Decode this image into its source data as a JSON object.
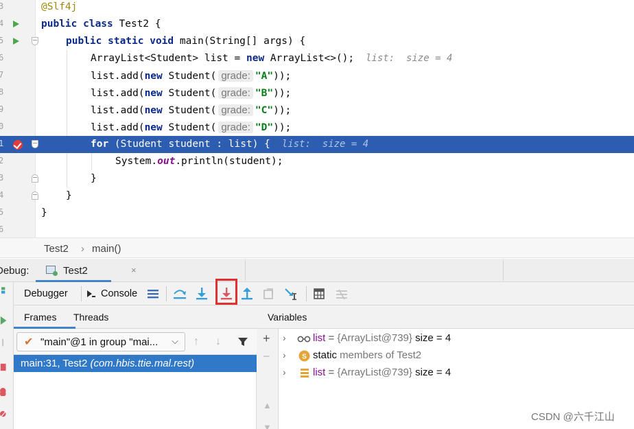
{
  "editor": {
    "lines": [
      {
        "num": "3",
        "tokens": [
          {
            "c": "ann",
            "t": "@Slf4j"
          }
        ]
      },
      {
        "num": "4",
        "tokens": [
          {
            "c": "kw",
            "t": "public "
          },
          {
            "c": "kw",
            "t": "class "
          },
          {
            "c": "",
            "t": "Test2 {"
          }
        ]
      },
      {
        "num": "5",
        "tokens": [
          {
            "c": "kw",
            "t": "public "
          },
          {
            "c": "kw",
            "t": "static "
          },
          {
            "c": "kw",
            "t": "void "
          },
          {
            "c": "",
            "t": "main(String[] args) {"
          }
        ]
      },
      {
        "num": "6",
        "tokens": [
          {
            "c": "",
            "t": "ArrayList<Student> list = "
          },
          {
            "c": "kw",
            "t": "new "
          },
          {
            "c": "",
            "t": "ArrayList<>();"
          },
          {
            "c": "inline-val",
            "t": "  list:  size = 4"
          }
        ]
      },
      {
        "num": "7",
        "tokens": [
          {
            "c": "",
            "t": "list.add("
          },
          {
            "c": "kw",
            "t": "new "
          },
          {
            "c": "",
            "t": "Student("
          },
          {
            "c": "hint",
            "t": "grade:"
          },
          {
            "c": "str",
            "t": "\"A\""
          },
          {
            "c": "",
            "t": "));"
          }
        ]
      },
      {
        "num": "8",
        "tokens": [
          {
            "c": "",
            "t": "list.add("
          },
          {
            "c": "kw",
            "t": "new "
          },
          {
            "c": "",
            "t": "Student("
          },
          {
            "c": "hint",
            "t": "grade:"
          },
          {
            "c": "str",
            "t": "\"B\""
          },
          {
            "c": "",
            "t": "));"
          }
        ]
      },
      {
        "num": "9",
        "tokens": [
          {
            "c": "",
            "t": "list.add("
          },
          {
            "c": "kw",
            "t": "new "
          },
          {
            "c": "",
            "t": "Student("
          },
          {
            "c": "hint",
            "t": "grade:"
          },
          {
            "c": "str",
            "t": "\"C\""
          },
          {
            "c": "",
            "t": "));"
          }
        ]
      },
      {
        "num": "0",
        "tokens": [
          {
            "c": "",
            "t": "list.add("
          },
          {
            "c": "kw",
            "t": "new "
          },
          {
            "c": "",
            "t": "Student("
          },
          {
            "c": "hint",
            "t": "grade:"
          },
          {
            "c": "str",
            "t": "\"D\""
          },
          {
            "c": "",
            "t": "));"
          }
        ]
      },
      {
        "num": "1",
        "tokens": [
          {
            "c": "kw",
            "t": "for "
          },
          {
            "c": "",
            "t": "(Student student : list) {"
          },
          {
            "c": "inline-val",
            "t": "  list:  size = 4"
          }
        ]
      },
      {
        "num": "2",
        "tokens": [
          {
            "c": "",
            "t": "System."
          },
          {
            "c": "stat",
            "t": "out"
          },
          {
            "c": "",
            "t": ".println(student);"
          }
        ]
      },
      {
        "num": "3",
        "tokens": [
          {
            "c": "",
            "t": "}"
          }
        ]
      },
      {
        "num": "4",
        "tokens": [
          {
            "c": "",
            "t": "}"
          }
        ]
      },
      {
        "num": "5",
        "tokens": [
          {
            "c": "",
            "t": "}"
          }
        ]
      },
      {
        "num": "6",
        "tokens": []
      }
    ]
  },
  "breadcrumb": {
    "class_name": "Test2",
    "separator": "›",
    "method": "main()"
  },
  "debug": {
    "title": "Debug:",
    "tab_label": "Test2",
    "tab_close": "×"
  },
  "toolbar": {
    "debugger_tab": "Debugger",
    "console_tab": "Console"
  },
  "frames": {
    "tab_frames": "Frames",
    "tab_threads": "Threads",
    "thread_selected": "\"main\"@1 in group \"mai...",
    "frame_method": "main:31, Test2 ",
    "frame_package": "(com.hbis.ttie.mal.rest)"
  },
  "variables": {
    "title": "Variables",
    "rows": [
      {
        "name": "list",
        "eq": " = ",
        "type": "{ArrayList@739}",
        "value": "  size = 4"
      },
      {
        "name": "static",
        "eq": "",
        "type": " members of Test2",
        "value": ""
      },
      {
        "name": "list",
        "eq": " = ",
        "type": "{ArrayList@739}",
        "value": "  size = 4"
      }
    ]
  },
  "watermark": "CSDN @六千江山",
  "colors": {
    "current_line": "#2d5db0",
    "selected_frame": "#2f79c8",
    "highlight_box": "#e03030",
    "accent": "#4083c9"
  }
}
